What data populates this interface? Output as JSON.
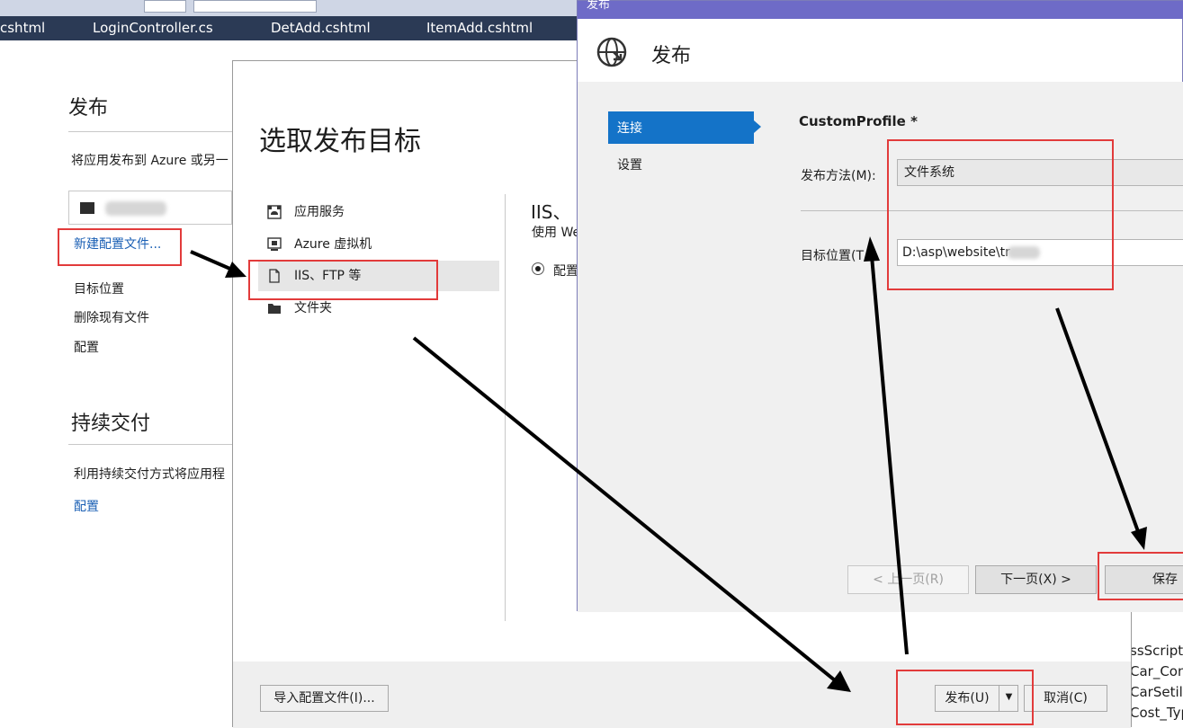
{
  "vs": {
    "tabs": [
      "cshtml",
      "LoginController.cs",
      "DetAdd.cshtml",
      "ItemAdd.cshtml"
    ]
  },
  "left_panel": {
    "publish_title": "发布",
    "publish_desc": "将应用发布到 Azure 或另一",
    "new_profile_link": "新建配置文件...",
    "items": [
      "目标位置",
      "删除现有文件",
      "配置"
    ],
    "cd_title": "持续交付",
    "cd_desc": "利用持续交付方式将应用程",
    "cd_link": "配置"
  },
  "pick_dialog": {
    "title": "选取发布目标",
    "targets": [
      {
        "label": "应用服务",
        "icon": "app-service-icon"
      },
      {
        "label": "Azure 虚拟机",
        "icon": "virtual-machine-icon"
      },
      {
        "label": "IIS、FTP 等",
        "icon": "file-icon"
      },
      {
        "label": "文件夹",
        "icon": "folder-icon"
      }
    ],
    "detail_title": "IIS、",
    "detail_desc": "使用 We",
    "radio_label": "配置",
    "import_button": "导入配置文件(I)...",
    "publish_button": "发布(U)",
    "cancel_button": "取消(C)"
  },
  "publish_dialog": {
    "window_title": "发布",
    "header_title": "发布",
    "nav": [
      "连接",
      "设置"
    ],
    "profile_name": "CustomProfile *",
    "method_label": "发布方法(M):",
    "method_value": "文件系统",
    "target_label": "目标位置(T",
    "target_value": "D:\\asp\\website\\tr",
    "prev_button": "< 上一页(R)",
    "next_button": "下一页(X) >",
    "save_button": "保存"
  },
  "background_code": [
    "ssScript",
    "Car_Cont",
    "CarSetile",
    "Cost_Typ"
  ],
  "colors": {
    "accent": "#1473c8",
    "annotation": "#e23b3b",
    "titlebar": "#6e6bc7"
  }
}
